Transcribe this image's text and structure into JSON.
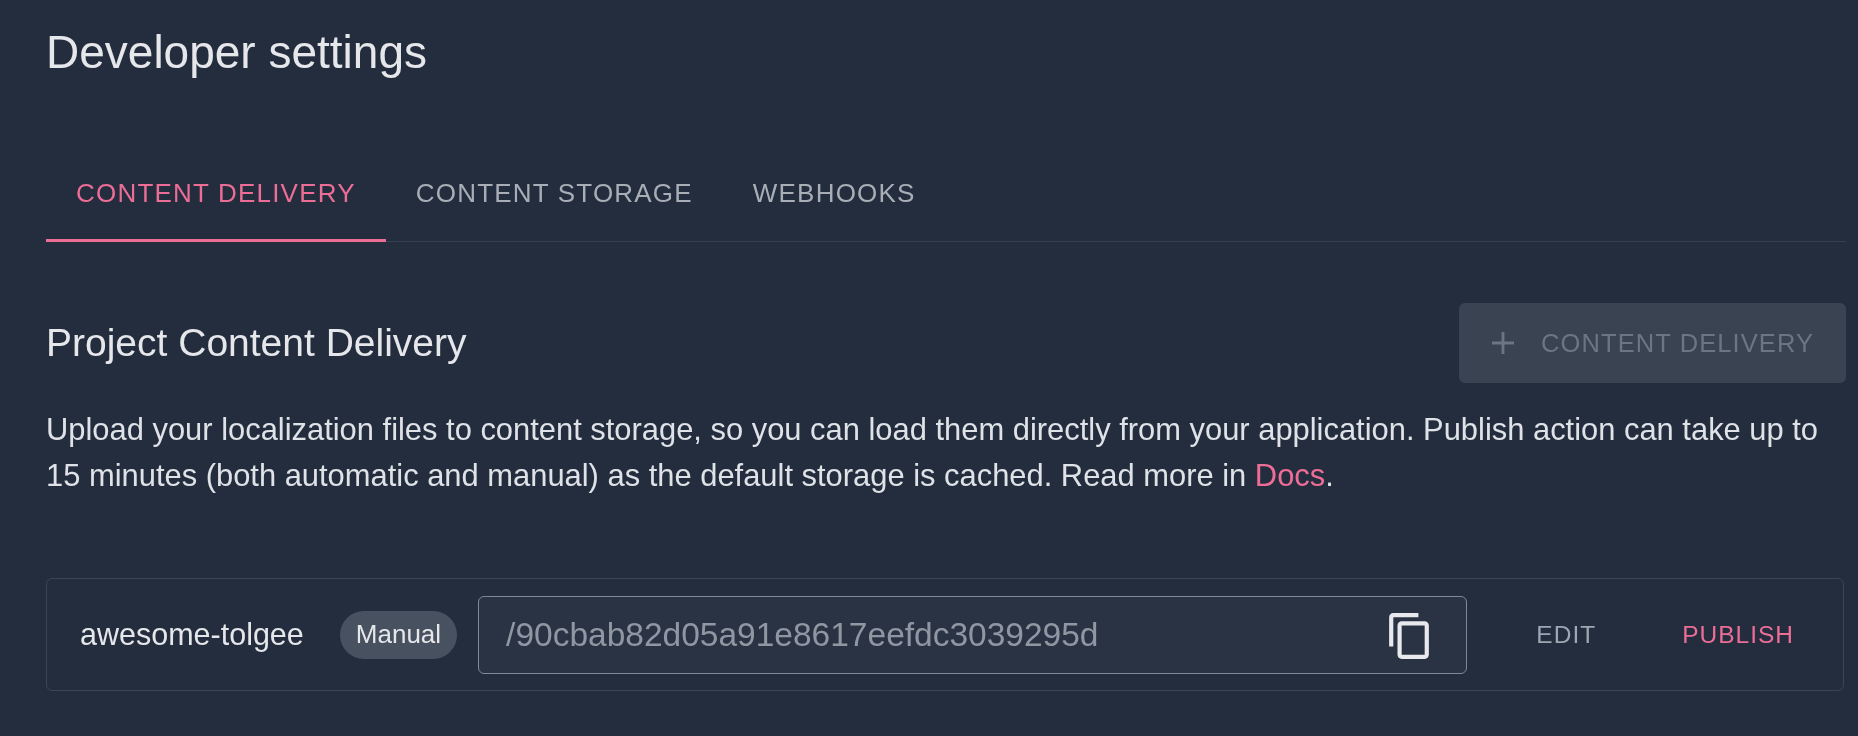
{
  "page": {
    "title": "Developer settings"
  },
  "tabs": [
    {
      "label": "CONTENT DELIVERY",
      "selected": true
    },
    {
      "label": "CONTENT STORAGE",
      "selected": false
    },
    {
      "label": "WEBHOOKS",
      "selected": false
    }
  ],
  "section": {
    "title": "Project Content Delivery",
    "add_button": {
      "label": "CONTENT DELIVERY",
      "disabled": true
    },
    "description": [
      {
        "kind": "text",
        "text": "Upload your localization files to content storage, so you can load them directly from your application. Publish action can take up to 15 minutes (both automatic and manual) as the default storage is cached. Read more in "
      },
      {
        "kind": "link",
        "text": "Docs"
      },
      {
        "kind": "text",
        "text": "."
      }
    ]
  },
  "deliveries": [
    {
      "name": "awesome-tolgee",
      "badge": "Manual",
      "url": "/90cbab82d05a91e8617eefdc3039295d",
      "actions": [
        {
          "label": "EDIT",
          "kind": "default"
        },
        {
          "label": "PUBLISH",
          "kind": "primary"
        }
      ]
    }
  ]
}
